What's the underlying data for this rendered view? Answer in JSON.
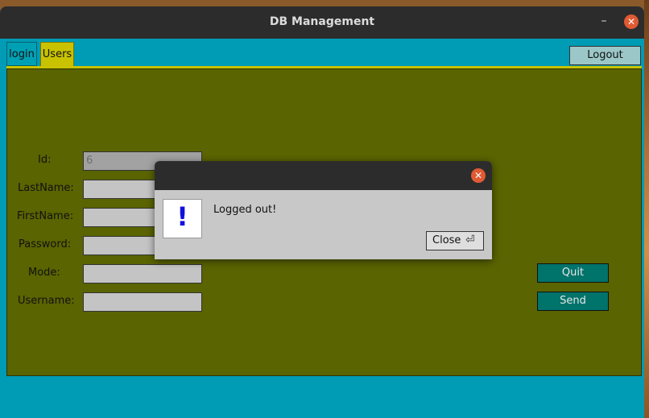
{
  "window": {
    "title": "DB Management",
    "minimize_symbol": "–",
    "close_symbol": "✕"
  },
  "tabs": [
    {
      "label": "login"
    },
    {
      "label": "Users"
    }
  ],
  "header": {
    "logout_label": "Logout"
  },
  "form": {
    "fields": [
      {
        "label": "Id:",
        "value": "6",
        "disabled": true
      },
      {
        "label": "LastName:",
        "value": ""
      },
      {
        "label": "FirstName:",
        "value": ""
      },
      {
        "label": "Password:",
        "value": ""
      },
      {
        "label": "Mode:",
        "value": ""
      },
      {
        "label": "Username:",
        "value": ""
      }
    ],
    "quit_label": "Quit",
    "send_label": "Send"
  },
  "dialog": {
    "icon": "!",
    "message": "Logged out!",
    "close_label": "Close",
    "close_symbol": "✕",
    "enter_icon": "⏎"
  },
  "colors": {
    "window_bg": "#009bb5",
    "panel_bg": "#5a6400",
    "active_tab": "#c9c200",
    "button_teal": "#00736a"
  }
}
